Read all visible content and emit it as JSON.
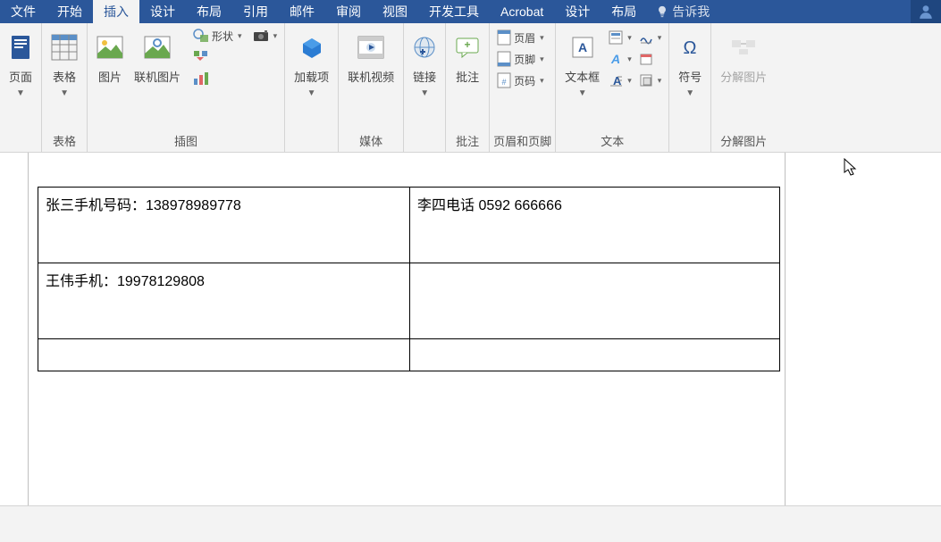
{
  "menu": {
    "items": [
      "文件",
      "开始",
      "插入",
      "设计",
      "布局",
      "引用",
      "邮件",
      "审阅",
      "视图",
      "开发工具",
      "Acrobat",
      "设计",
      "布局"
    ],
    "active_index": 2,
    "tell_me": "告诉我"
  },
  "ribbon": {
    "groups": [
      {
        "name": "pages",
        "label": "",
        "items": [
          {
            "label": "页面",
            "type": "big",
            "dd": true
          }
        ]
      },
      {
        "name": "tables",
        "label": "表格",
        "items": [
          {
            "label": "表格",
            "type": "big",
            "dd": true
          }
        ]
      },
      {
        "name": "illustrations",
        "label": "插图",
        "items": [
          {
            "label": "图片",
            "type": "big"
          },
          {
            "label": "联机图片",
            "type": "big"
          },
          {
            "label": "形状",
            "type": "small",
            "dd": true
          },
          {
            "label": "",
            "type": "icon_only_row"
          }
        ]
      },
      {
        "name": "addins",
        "label": "",
        "items": [
          {
            "label": "加载项",
            "type": "big",
            "dd": true
          }
        ]
      },
      {
        "name": "media",
        "label": "媒体",
        "items": [
          {
            "label": "联机视频",
            "type": "big"
          }
        ]
      },
      {
        "name": "links",
        "label": "",
        "items": [
          {
            "label": "链接",
            "type": "big",
            "dd": true
          }
        ]
      },
      {
        "name": "comments",
        "label": "批注",
        "items": [
          {
            "label": "批注",
            "type": "big"
          }
        ]
      },
      {
        "name": "header_footer",
        "label": "页眉和页脚",
        "items": [
          {
            "label": "页眉",
            "type": "small",
            "dd": true
          },
          {
            "label": "页脚",
            "type": "small",
            "dd": true
          },
          {
            "label": "页码",
            "type": "small",
            "dd": true
          }
        ]
      },
      {
        "name": "text",
        "label": "文本",
        "items": [
          {
            "label": "文本框",
            "type": "big",
            "dd": true
          }
        ]
      },
      {
        "name": "symbols",
        "label": "",
        "items": [
          {
            "label": "符号",
            "type": "big",
            "dd": true
          }
        ]
      },
      {
        "name": "decompose",
        "label": "分解图片",
        "items": [
          {
            "label": "分解图片",
            "type": "big",
            "disabled": true
          }
        ]
      }
    ]
  },
  "document": {
    "table": {
      "rows": [
        [
          "张三手机号码：138978989778",
          "李四电话 0592 666666"
        ],
        [
          "王伟手机：19978129808",
          ""
        ],
        [
          "",
          ""
        ]
      ]
    }
  }
}
